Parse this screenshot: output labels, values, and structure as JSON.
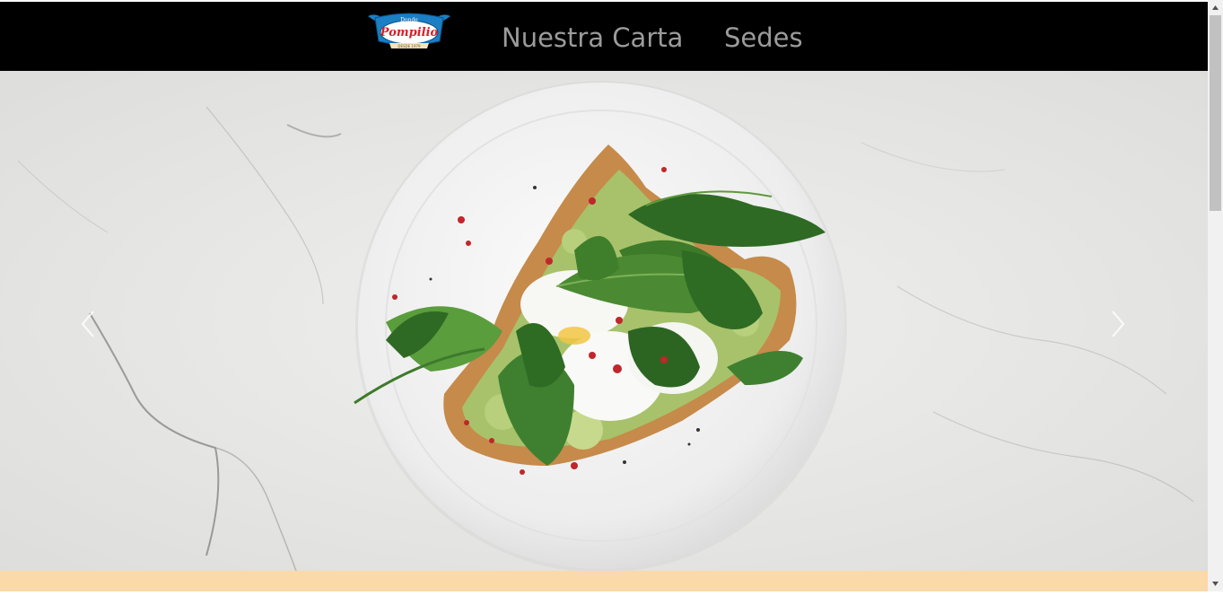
{
  "navbar": {
    "logo": {
      "text_top": "Donde",
      "text_main": "Pompilio",
      "text_bottom": "DESDE 1979"
    },
    "links": [
      {
        "label": "Nuestra Carta"
      },
      {
        "label": "Sedes"
      }
    ]
  },
  "hero": {
    "slide_image": "avocado-toast-poached-egg-spinach-plate-on-marble",
    "prev_icon": "chevron-left-icon",
    "next_icon": "chevron-right-icon"
  },
  "colors": {
    "navbar_bg": "#000000",
    "nav_link": "#9b9b9b",
    "bottom_band": "#fbd9a8",
    "logo_banner": "#1a7fc4",
    "logo_text": "#d81f26"
  }
}
